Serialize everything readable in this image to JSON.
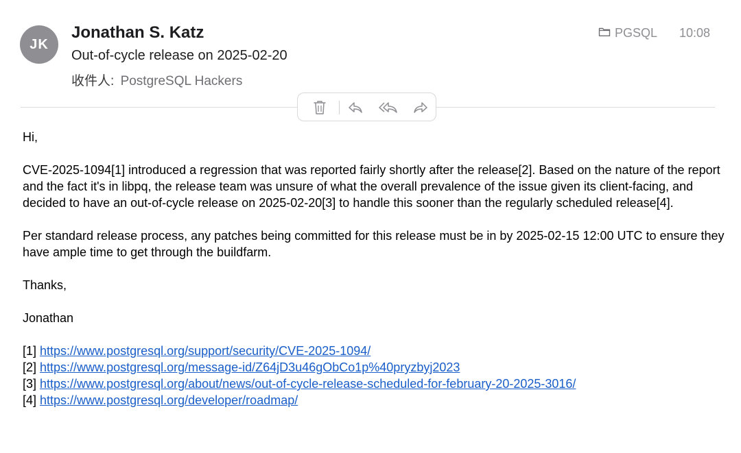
{
  "header": {
    "avatar_initials": "JK",
    "avatar_color": "#8e8e93",
    "sender": "Jonathan S. Katz",
    "subject": "Out-of-cycle release on 2025-02-20",
    "recipients_label": "收件人:",
    "recipients": "PostgreSQL Hackers",
    "mailbox": "PGSQL",
    "mailbox_icon": "folder-icon",
    "time": "10:08"
  },
  "toolbar": {
    "buttons": [
      "trash-icon",
      "reply-icon",
      "reply-all-icon",
      "forward-icon"
    ]
  },
  "message": {
    "greeting": "Hi,",
    "para1": "CVE-2025-1094[1] introduced a regression that was reported fairly shortly after the release[2]. Based on the nature of the report and the fact it's in libpq, the release team was unsure of what the overall prevalence of the issue given its client-facing, and decided to have an out-of-cycle release on 2025-02-20[3] to handle this sooner than the regularly scheduled release[4].",
    "para2": "Per standard release process, any patches being committed for this release must be in by 2025-02-15 12:00 UTC to ensure they have ample time to get through the buildfarm.",
    "thanks": "Thanks,",
    "signature": "Jonathan",
    "references": [
      {
        "marker": "[1]",
        "url": "https://www.postgresql.org/support/security/CVE-2025-1094/"
      },
      {
        "marker": "[2]",
        "url": "https://www.postgresql.org/message-id/Z64jD3u46gObCo1p%40pryzbyj2023"
      },
      {
        "marker": "[3]",
        "url": "https://www.postgresql.org/about/news/out-of-cycle-release-scheduled-for-february-20-2025-3016/"
      },
      {
        "marker": "[4]",
        "url": "https://www.postgresql.org/developer/roadmap/"
      }
    ]
  },
  "colors": {
    "link": "#1a5ec9",
    "muted": "#8e8e93"
  }
}
